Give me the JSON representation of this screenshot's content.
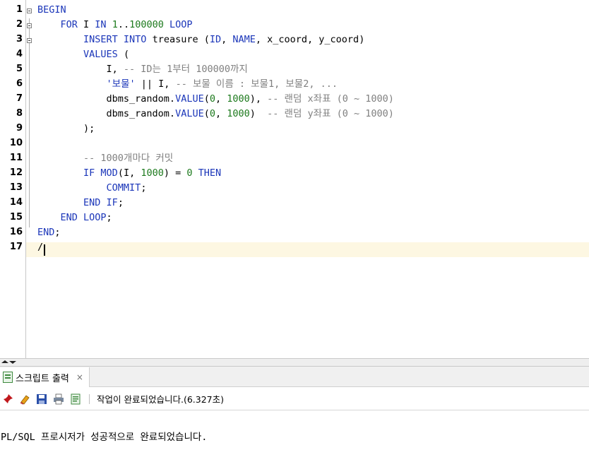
{
  "editor": {
    "line_numbers": [
      "1",
      "2",
      "3",
      "4",
      "5",
      "6",
      "7",
      "8",
      "9",
      "10",
      "11",
      "12",
      "13",
      "14",
      "15",
      "16",
      "17"
    ],
    "lines": [
      [
        {
          "t": "BEGIN",
          "c": "kw"
        }
      ],
      [
        {
          "t": "    "
        },
        {
          "t": "FOR",
          "c": "kw"
        },
        {
          "t": " I "
        },
        {
          "t": "IN",
          "c": "kw"
        },
        {
          "t": " "
        },
        {
          "t": "1",
          "c": "num"
        },
        {
          "t": ".."
        },
        {
          "t": "100000",
          "c": "num"
        },
        {
          "t": " "
        },
        {
          "t": "LOOP",
          "c": "kw"
        }
      ],
      [
        {
          "t": "        "
        },
        {
          "t": "INSERT INTO",
          "c": "kw"
        },
        {
          "t": " treasure ("
        },
        {
          "t": "ID",
          "c": "kw"
        },
        {
          "t": ", "
        },
        {
          "t": "NAME",
          "c": "kw"
        },
        {
          "t": ", x_coord, y_coord)"
        }
      ],
      [
        {
          "t": "        "
        },
        {
          "t": "VALUES",
          "c": "kw"
        },
        {
          "t": " ("
        }
      ],
      [
        {
          "t": "            I, "
        },
        {
          "t": "-- ID는 1부터 100000까지",
          "c": "cm"
        }
      ],
      [
        {
          "t": "            "
        },
        {
          "t": "'보물'",
          "c": "str"
        },
        {
          "t": " || I, "
        },
        {
          "t": "-- 보물 이름 : 보물1, 보물2, ...",
          "c": "cm"
        }
      ],
      [
        {
          "t": "            dbms_random."
        },
        {
          "t": "VALUE",
          "c": "kw"
        },
        {
          "t": "("
        },
        {
          "t": "0",
          "c": "num"
        },
        {
          "t": ", "
        },
        {
          "t": "1000",
          "c": "num"
        },
        {
          "t": "), "
        },
        {
          "t": "-- 랜덤 x좌표 (0 ~ 1000)",
          "c": "cm"
        }
      ],
      [
        {
          "t": "            dbms_random."
        },
        {
          "t": "VALUE",
          "c": "kw"
        },
        {
          "t": "("
        },
        {
          "t": "0",
          "c": "num"
        },
        {
          "t": ", "
        },
        {
          "t": "1000",
          "c": "num"
        },
        {
          "t": ")  "
        },
        {
          "t": "-- 랜덤 y좌표 (0 ~ 1000)",
          "c": "cm"
        }
      ],
      [
        {
          "t": "        );"
        }
      ],
      [
        {
          "t": ""
        }
      ],
      [
        {
          "t": "        "
        },
        {
          "t": "-- 1000개마다 커밋",
          "c": "cm"
        }
      ],
      [
        {
          "t": "        "
        },
        {
          "t": "IF MOD",
          "c": "kw"
        },
        {
          "t": "(I, "
        },
        {
          "t": "1000",
          "c": "num"
        },
        {
          "t": ") = "
        },
        {
          "t": "0",
          "c": "num"
        },
        {
          "t": " "
        },
        {
          "t": "THEN",
          "c": "kw"
        }
      ],
      [
        {
          "t": "            "
        },
        {
          "t": "COMMIT",
          "c": "kw"
        },
        {
          "t": ";"
        }
      ],
      [
        {
          "t": "        "
        },
        {
          "t": "END IF",
          "c": "kw"
        },
        {
          "t": ";"
        }
      ],
      [
        {
          "t": "    "
        },
        {
          "t": "END LOOP",
          "c": "kw"
        },
        {
          "t": ";"
        }
      ],
      [
        {
          "t": "END",
          "c": "kw"
        },
        {
          "t": ";"
        }
      ],
      [
        {
          "t": "/"
        }
      ]
    ]
  },
  "output_panel": {
    "tab_label": "스크립트 출력",
    "tab_close": "×",
    "status_text": "작업이 완료되었습니다.(6.327초)",
    "output_text": "PL/SQL 프로시저가 성공적으로 완료되었습니다.",
    "toolbar_icons": [
      "pin-icon",
      "eraser-icon",
      "save-icon",
      "print-icon",
      "document-icon"
    ]
  },
  "colors": {
    "keyword": "#1b36b9",
    "number": "#1d7a1d",
    "comment": "#808080",
    "current_line": "#fdf7e2"
  }
}
